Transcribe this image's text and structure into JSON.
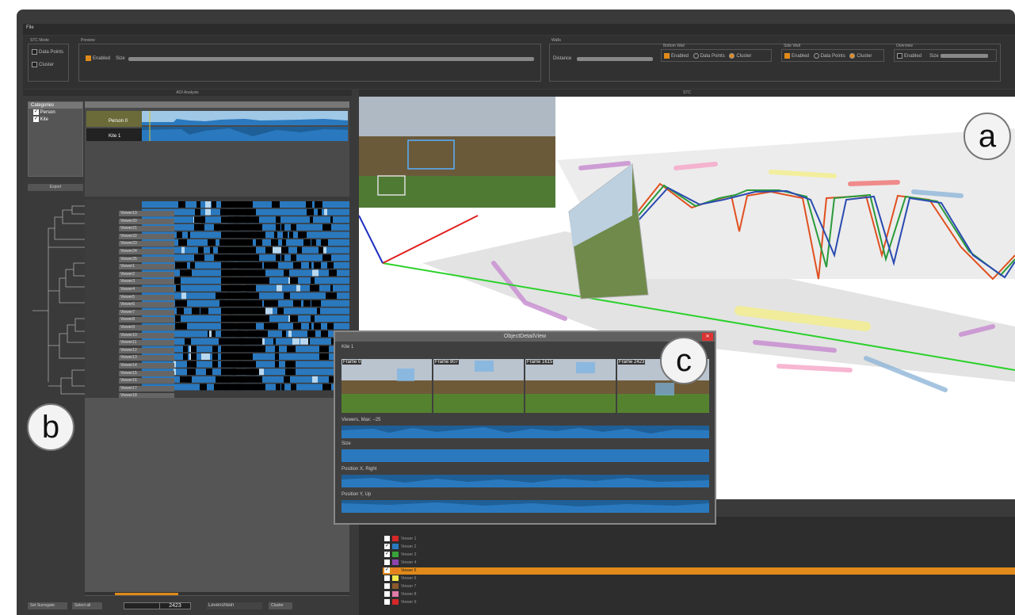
{
  "menu": {
    "file": "File"
  },
  "toolbar": {
    "stc_mode": {
      "title": "STC Mode",
      "data_points": "Data Points",
      "cluster": "Cluster"
    },
    "preview": {
      "title": "Preview",
      "enabled": "Enabled",
      "size": "Size"
    },
    "walls": {
      "title": "Walls",
      "distance": "Distance"
    },
    "bottom_wall": {
      "title": "Bottom Wall",
      "enabled": "Enabled",
      "data_points": "Data Points",
      "cluster": "Cluster"
    },
    "side_wall": {
      "title": "Side Wall",
      "enabled": "Enabled",
      "data_points": "Data Points",
      "cluster": "Cluster"
    },
    "overview": {
      "title": "Overview",
      "enabled": "Enabled",
      "size": "Size"
    }
  },
  "aoi_panel": {
    "title": "AOI Analysis",
    "categories_title": "Categories",
    "categories": [
      "Person",
      "Kite"
    ],
    "export": "Export",
    "objects": [
      "Person 0",
      "Kite 1"
    ],
    "viewers": [
      "Viewer19",
      "Viewer20",
      "Viewer21",
      "Viewer22",
      "Viewer23",
      "Viewer24",
      "Viewer25",
      "Viewer1",
      "Viewer2",
      "Viewer3",
      "Viewer4",
      "Viewer5",
      "Viewer6",
      "Viewer7",
      "Viewer8",
      "Viewer9",
      "Viewer10",
      "Viewer11",
      "Viewer12",
      "Viewer13",
      "Viewer14",
      "Viewer15",
      "Viewer16",
      "Viewer17",
      "Viewer18"
    ]
  },
  "bottom_bar": {
    "set_surrogate": "Set Surrogate",
    "select_all": "Select all",
    "frame_value": "2423",
    "method": "Levenshtein",
    "cluster": "Cluster"
  },
  "stc_panel": {
    "title": "STC",
    "badge": "a"
  },
  "badges": {
    "b": "b",
    "c": "c"
  },
  "detail_window": {
    "title": "ObjectDetailView",
    "object_label": "Kite 1",
    "frames": [
      "Frame 0",
      "Frame 807",
      "Frame 1615",
      "Frame 2423"
    ],
    "viewers_row": "Viewers, Max: −25",
    "size_row": "Size",
    "pos_x_row": "Position X, Right",
    "pos_y_row": "Position Y, Up"
  },
  "viewer_list": [
    {
      "name": "Viewer 1",
      "color": "#d62828",
      "checked": false
    },
    {
      "name": "Viewer 2",
      "color": "#2a79bf",
      "checked": true
    },
    {
      "name": "Viewer 3",
      "color": "#3aa33a",
      "checked": true
    },
    {
      "name": "Viewer 4",
      "color": "#8e44ad",
      "checked": false
    },
    {
      "name": "Viewer 5",
      "color": "#e67e22",
      "checked": true
    },
    {
      "name": "Viewer 6",
      "color": "#f1e84a",
      "checked": false
    },
    {
      "name": "Viewer 7",
      "color": "#8b5a2b",
      "checked": false
    },
    {
      "name": "Viewer 8",
      "color": "#e07aa8",
      "checked": false
    },
    {
      "name": "Viewer 9",
      "color": "#d62828",
      "checked": false
    }
  ]
}
